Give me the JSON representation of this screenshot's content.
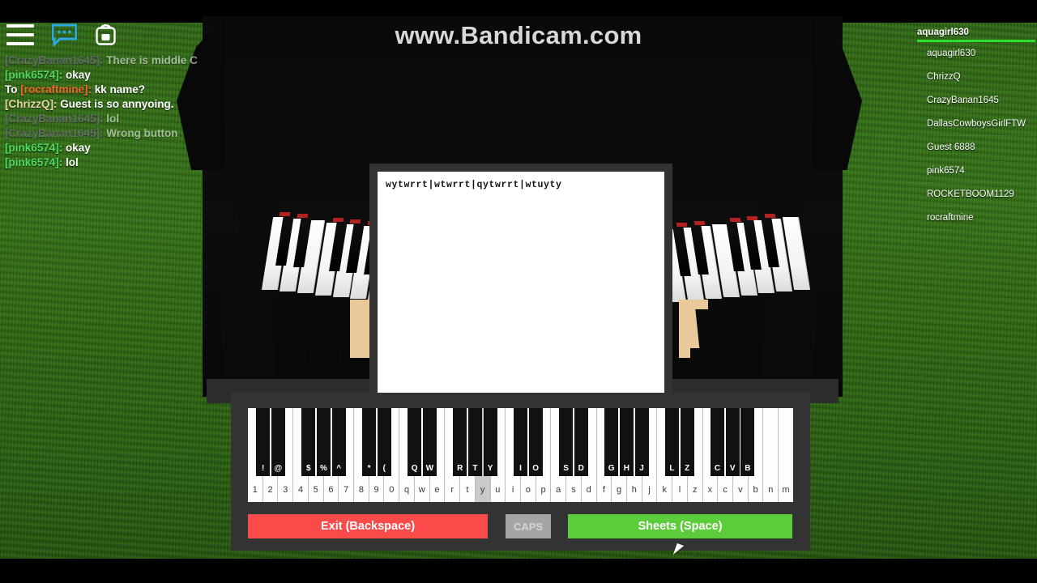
{
  "watermark": {
    "text": "www.Bandicam.com"
  },
  "topbar": {
    "menu_icon": "hamburger-menu-icon",
    "chat_icon": "chat-bubble-icon",
    "backpack_icon": "backpack-icon"
  },
  "chat": {
    "lines": [
      {
        "prefix": "",
        "who": "[CrazyBanan1645]:",
        "who_color": "#8f6ea8",
        "msg": "There is middle C",
        "faded": true
      },
      {
        "prefix": "",
        "who": "[pink6574]:",
        "who_color": "#4fd962",
        "msg": "okay",
        "faded": false
      },
      {
        "prefix": "To ",
        "who": "[rocraftmine]:",
        "who_color": "#f4682a",
        "msg": "kk name?",
        "faded": false
      },
      {
        "prefix": "",
        "who": "[ChrizzQ]:",
        "who_color": "#e9d5a8",
        "msg": "Guest is so annyoing.",
        "faded": false
      },
      {
        "prefix": "",
        "who": "[CrazyBanan1645]:",
        "who_color": "#8f6ea8",
        "msg": "lol",
        "faded": true
      },
      {
        "prefix": "",
        "who": "[CrazyBanan1645]:",
        "who_color": "#8f6ea8",
        "msg": "Wrong button",
        "faded": true
      },
      {
        "prefix": "",
        "who": "[pink6574]:",
        "who_color": "#4fd962",
        "msg": "okay",
        "faded": false
      },
      {
        "prefix": "",
        "who": "[pink6574]:",
        "who_color": "#4fd962",
        "msg": "lol",
        "faded": false
      }
    ]
  },
  "player_list": {
    "header": "aquagirl630",
    "accent_color": "#2fdd2f",
    "players": [
      "aquagirl630",
      "ChrizzQ",
      "CrazyBanan1645",
      "DallasCowboysGirlFTW",
      "Guest 6888",
      "pink6574",
      "ROCKETBOOM1129",
      "rocraftmine"
    ]
  },
  "sheet": {
    "content": "wytwrrt|wtwrrt|qytwrrt|wtuyty"
  },
  "piano_gui": {
    "white_keys": [
      "1",
      "2",
      "3",
      "4",
      "5",
      "6",
      "7",
      "8",
      "9",
      "0",
      "q",
      "w",
      "e",
      "r",
      "t",
      "y",
      "u",
      "i",
      "o",
      "p",
      "a",
      "s",
      "d",
      "f",
      "g",
      "h",
      "j",
      "k",
      "l",
      "z",
      "x",
      "c",
      "v",
      "b",
      "n",
      "m"
    ],
    "active_white_key": "y",
    "black_keys": [
      {
        "label": "!",
        "after_index": 0
      },
      {
        "label": "@",
        "after_index": 1
      },
      {
        "label": "$",
        "after_index": 3
      },
      {
        "label": "%",
        "after_index": 4
      },
      {
        "label": "^",
        "after_index": 5
      },
      {
        "label": "*",
        "after_index": 7
      },
      {
        "label": "(",
        "after_index": 8
      },
      {
        "label": "Q",
        "after_index": 10
      },
      {
        "label": "W",
        "after_index": 11
      },
      {
        "label": "R",
        "after_index": 13
      },
      {
        "label": "T",
        "after_index": 14
      },
      {
        "label": "Y",
        "after_index": 15
      },
      {
        "label": "I",
        "after_index": 17
      },
      {
        "label": "O",
        "after_index": 18
      },
      {
        "label": "S",
        "after_index": 20
      },
      {
        "label": "D",
        "after_index": 21
      },
      {
        "label": "G",
        "after_index": 23
      },
      {
        "label": "H",
        "after_index": 24
      },
      {
        "label": "J",
        "after_index": 25
      },
      {
        "label": "L",
        "after_index": 27
      },
      {
        "label": "Z",
        "after_index": 28
      },
      {
        "label": "C",
        "after_index": 30
      },
      {
        "label": "V",
        "after_index": 31
      },
      {
        "label": "B",
        "after_index": 32
      }
    ],
    "exit_button": "Exit (Backspace)",
    "caps_button": "CAPS",
    "sheets_button": "Sheets (Space)",
    "colors": {
      "exit": "#fb4a4a",
      "caps": "#a5a5a5",
      "sheets": "#5bcc3a",
      "panel": "#333333"
    }
  }
}
